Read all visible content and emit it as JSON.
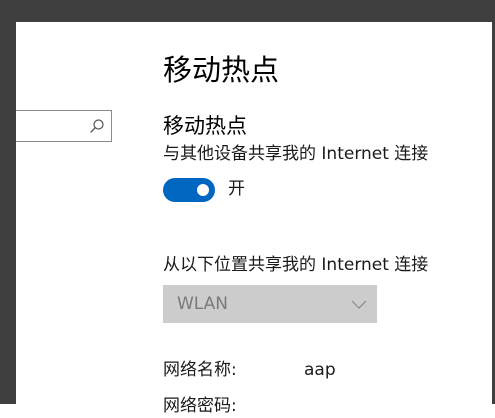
{
  "page": {
    "title": "移动热点"
  },
  "hotspot": {
    "section_title": "移动热点",
    "share_description": "与其他设备共享我的 Internet 连接",
    "toggle_state_label": "开",
    "toggle_on": true,
    "accent_color": "#0067c0"
  },
  "share_from": {
    "label": "从以下位置共享我的 Internet 连接",
    "selected": "WLAN",
    "disabled": true
  },
  "network": {
    "name_label": "网络名称:",
    "name_value": "aap",
    "password_label": "网络密码:"
  },
  "search": {
    "icon": "search-icon"
  }
}
